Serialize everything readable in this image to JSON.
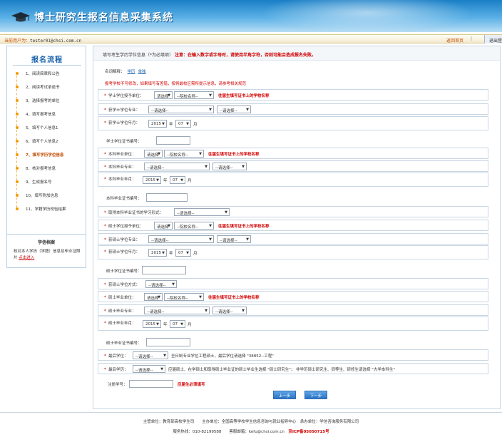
{
  "header": {
    "title": "博士研究生报名信息采集系统"
  },
  "userbar": {
    "label": "当前用户为：",
    "username": "tester01@chsi.com.cn",
    "home": "返回首页",
    "sep": "|",
    "logout": "退出登"
  },
  "sidebar": {
    "title": "报名流程",
    "steps": [
      {
        "label": "1、阅读简章和公告",
        "active": false
      },
      {
        "label": "2、阅读考试承诺书",
        "active": false
      },
      {
        "label": "3、选择报考的单位",
        "active": false
      },
      {
        "label": "4、填写报考信息",
        "active": false
      },
      {
        "label": "5、填写个人信息1",
        "active": false
      },
      {
        "label": "6、填写个人信息2",
        "active": false
      },
      {
        "label": "7、填写学历学位信息",
        "active": true
      },
      {
        "label": "8、核对报考信息",
        "active": false
      },
      {
        "label": "9、生成报名号",
        "active": false
      },
      {
        "label": "10、填写附加信息",
        "active": false
      },
      {
        "label": "11、学籍学历校验结果",
        "active": false
      }
    ],
    "archive_title": "学信档案",
    "archive_text": "核对本人学历（学籍）信息及毕业证照片",
    "archive_link": "点击进入"
  },
  "main": {
    "topnote_prefix": "填写考生学历学位信息（*为必填项）",
    "topnote_warning": "注意：在输入数字或字母时，请使用半角字符，否则可能会造成报名失败。",
    "expl_prefix": "名词解释：",
    "expl_links": [
      "学历",
      "单独"
    ],
    "warn_text": "报考学校不可修改，如果填写有差错，按将最校区需所提示信息，请参考相关规范",
    "fields": {
      "bachelor_degree_unit": {
        "label": "学士学位授予单位：",
        "select1": "请选择",
        "select2": "--院校名称--",
        "note": "往届生填写证书上的学校名称"
      },
      "bachelor_major": {
        "label": "获学士学位专业：",
        "select1": "--请选择--",
        "select2": "--请选择--"
      },
      "bachelor_year": {
        "label": "获学士学位年月：",
        "year": "2015",
        "year_unit": "年",
        "month": "07",
        "month_unit": "月"
      },
      "bachelor_cert": {
        "label": "学士学位证书编号："
      },
      "ug_unit": {
        "label": "本科毕业单位：",
        "select1": "请选择",
        "select2": "--院校名称--",
        "note": "往届生填写证书上的学校名称"
      },
      "ug_major": {
        "label": "本科毕业专业：",
        "select1": "--请选择--",
        "select2": "--请选择--"
      },
      "ug_year": {
        "label": "本科毕业年月：",
        "year": "2015",
        "year_unit": "年",
        "month": "07",
        "month_unit": "月"
      },
      "ug_cert": {
        "label": "本科毕业证书编号："
      },
      "ug_mode": {
        "label": "取得本科毕业证书的学习形式：",
        "select": "--请选择--"
      },
      "master_degree_unit": {
        "label": "硕士学位授予单位：",
        "select1": "请选择",
        "select2": "--院校名称--",
        "note": "往届生填写证书上的学校名称"
      },
      "master_major": {
        "label": "获硕士学位专业：",
        "select1": "--请选择--",
        "select2": "--请选择--"
      },
      "master_year": {
        "label": "获硕士学位年月：",
        "year": "2015",
        "year_unit": "年",
        "month": "07",
        "month_unit": "月"
      },
      "master_cert": {
        "label": "硕士学位证书编号："
      },
      "master_mode": {
        "label": "获硕士学位方式：",
        "select": "--请选择--"
      },
      "master_grad_unit": {
        "label": "硕士毕业单位：",
        "select1": "请选择",
        "select2": "--院校名称--",
        "note": "往届生填写证书上的学校名称"
      },
      "master_grad_major": {
        "label": "硕士毕业专业：",
        "select1": "--请选择--",
        "select2": "--请选择--"
      },
      "master_grad_year": {
        "label": "硕士毕业年月：",
        "year": "2015",
        "year_unit": "年",
        "month": "07",
        "month_unit": "月"
      },
      "master_grad_cert": {
        "label": "硕士毕业证书编号："
      },
      "highest_degree": {
        "label": "最后学位：",
        "select": "--请选择--",
        "note": "全日制专业学位工程硕士，最后学位请选择 \"38852--工程\""
      },
      "highest_edu": {
        "label": "最后学历：",
        "select": "--请选择--",
        "note": "应届硕士、在学硕士和取得硕士毕业证的硕士毕业生选择 \"硕士研究生\"； 非学历硕士研究生、同等生、研修生请选择 \"大学本科生\""
      },
      "reg_number": {
        "label": "注册学号：",
        "note": "应届生必须填写"
      }
    },
    "prev_button": "上一步",
    "next_button": "下一步"
  },
  "footer": {
    "line1": "主管单位：教育部高校学生司　　主办单位：全国高等学校学生信息咨询与就业指导中心　承办单位：学信咨询服务有限公司",
    "phone_label": "服务热线：010-82199588　　客服邮箱：",
    "email": "kefu@chsi.com.cn",
    "icp": "京ICP备05050715号"
  },
  "colors": {
    "accent": "#1b63ad",
    "warning": "#d10000",
    "step_orange": "#f39a00"
  }
}
